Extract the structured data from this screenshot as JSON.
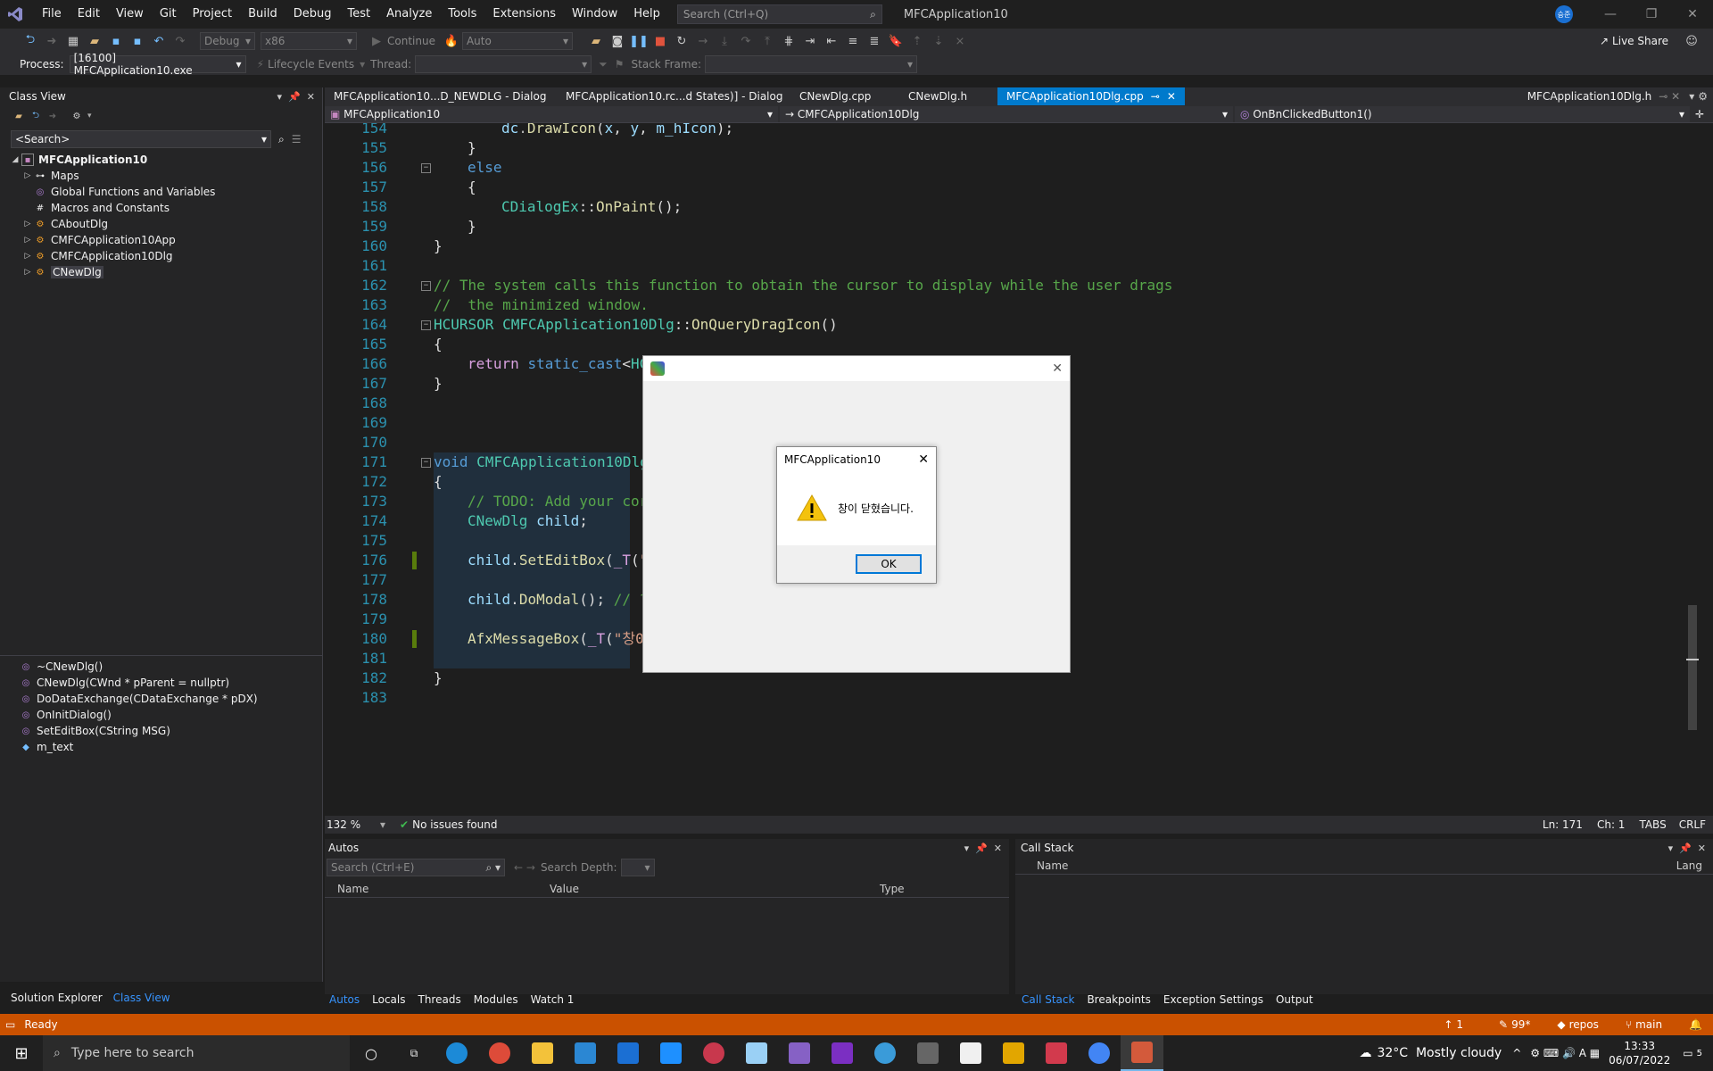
{
  "menu": [
    "File",
    "Edit",
    "View",
    "Git",
    "Project",
    "Build",
    "Debug",
    "Test",
    "Analyze",
    "Tools",
    "Extensions",
    "Window",
    "Help"
  ],
  "search": {
    "placeholder": "Search (Ctrl+Q)"
  },
  "app_title": "MFCApplication10",
  "user_initials": "승준",
  "live_share": "Live Share",
  "toolbar": {
    "config": "Debug",
    "platform": "x86",
    "continue": "Continue",
    "auto": "Auto"
  },
  "toolbar2": {
    "process_label": "Process:",
    "process": "[16100] MFCApplication10.exe",
    "lifecycle": "Lifecycle Events",
    "thread": "Thread:",
    "stack_frame": "Stack Frame:"
  },
  "classview": {
    "title": "Class View",
    "search": "<Search>",
    "items": [
      {
        "label": "MFCApplication10",
        "root": true
      },
      {
        "label": "Maps"
      },
      {
        "label": "Global Functions and Variables"
      },
      {
        "label": "Macros and Constants"
      },
      {
        "label": "CAboutDlg"
      },
      {
        "label": "CMFCApplication10App"
      },
      {
        "label": "CMFCApplication10Dlg"
      },
      {
        "label": "CNewDlg",
        "selected": true
      }
    ],
    "members": [
      "~CNewDlg()",
      "CNewDlg(CWnd * pParent = nullptr)",
      "DoDataExchange(CDataExchange * pDX)",
      "OnInitDialog()",
      "SetEditBox(CString MSG)",
      "m_text"
    ]
  },
  "editor_tabs": [
    "MFCApplication10...D_NEWDLG - Dialog",
    "MFCApplication10.rc...d States)] - Dialog",
    "CNewDlg.cpp",
    "CNewDlg.h",
    "MFCApplication10Dlg.cpp",
    "MFCApplication10Dlg.h"
  ],
  "nav": {
    "project": "MFCApplication10",
    "class": "CMFCApplication10Dlg",
    "method": "OnBnClickedButton1()"
  },
  "code": {
    "l154": "dc.DrawIcon(x, y, m_hIcon);",
    "l162": "// The system calls this function to obtain the cursor to display while the user drags",
    "l163": "//  the minimized window.",
    "l173": "// TODO: Add your cor"
  },
  "editor_status": {
    "zoom": "132 %",
    "issues": "No issues found",
    "ln": "Ln: 171",
    "ch": "Ch: 1",
    "tabs": "TABS",
    "crlf": "CRLF"
  },
  "autos": {
    "title": "Autos",
    "search": "Search (Ctrl+E)",
    "depth": "Search Depth:",
    "cols": [
      "Name",
      "Value",
      "Type"
    ]
  },
  "callstack": {
    "title": "Call Stack",
    "cols": [
      "Name",
      "Lang"
    ]
  },
  "bottom_tabs_left": [
    "Autos",
    "Locals",
    "Threads",
    "Modules",
    "Watch 1"
  ],
  "bottom_tabs_right": [
    "Call Stack",
    "Breakpoints",
    "Exception Settings",
    "Output"
  ],
  "left_tabs": [
    "Solution Explorer",
    "Class View"
  ],
  "status": {
    "ready": "Ready",
    "up": "1",
    "pencil": "99*",
    "repo": "repos",
    "branch": "main"
  },
  "dialog": {
    "title": "MFCApplication10",
    "message": "창이 닫혔습니다.",
    "ok": "OK"
  },
  "taskbar": {
    "search": "Type here to search",
    "weather": "32°C  Mostly cloudy",
    "time": "13:33",
    "date": "06/07/2022",
    "notif": "5"
  }
}
